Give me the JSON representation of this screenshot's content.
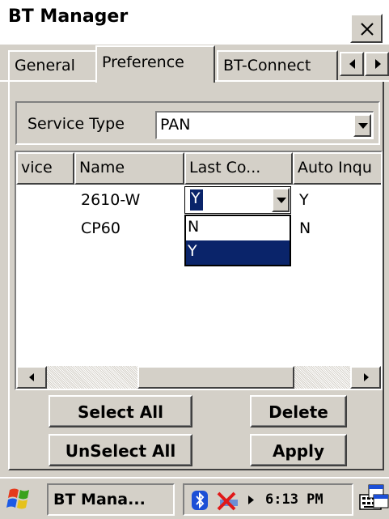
{
  "window": {
    "title": "BT Manager",
    "close_label": "×"
  },
  "tabs": [
    {
      "label": "General",
      "active": false
    },
    {
      "label": "Preference",
      "active": true
    },
    {
      "label": "BT-Connect",
      "active": false
    }
  ],
  "service": {
    "label": "Service Type",
    "value": "PAN"
  },
  "table": {
    "columns": [
      "vice",
      "Name",
      "Last Co...",
      "Auto Inqu"
    ],
    "rows": [
      {
        "name": "2610-W",
        "last_connect": "Y",
        "auto_inquiry": "Y"
      },
      {
        "name": "CP60",
        "last_connect": "",
        "auto_inquiry": "N"
      }
    ],
    "dropdown_options": [
      "N",
      "Y"
    ],
    "dropdown_selected": "Y"
  },
  "buttons": {
    "select_all": "Select All",
    "unselect_all": "UnSelect All",
    "delete": "Delete",
    "apply": "Apply"
  },
  "taskbar": {
    "task_label": "BT Mana...",
    "time": "6:13 PM"
  },
  "colors": {
    "selection": "#0a246a",
    "face": "#d4d0c8"
  }
}
